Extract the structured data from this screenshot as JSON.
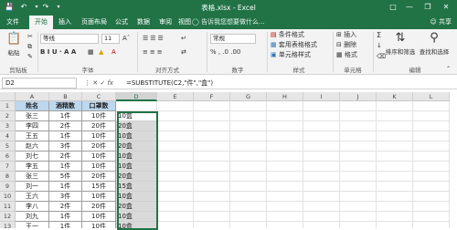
{
  "titlebar": {
    "title": "表格.xlsx - Excel",
    "icons": [
      "save-icon",
      "undo-icon",
      "redo-icon",
      "customize-icon"
    ],
    "window_buttons": [
      "ribbon-options-icon",
      "minimize-icon",
      "restore-icon",
      "close-icon"
    ]
  },
  "tabs": [
    "文件",
    "开始",
    "插入",
    "页面布局",
    "公式",
    "数据",
    "审阅",
    "视图"
  ],
  "active_tab": "开始",
  "tell_me": "告诉我您想要做什么...",
  "share": "共享",
  "ribbon": {
    "paste": "粘贴",
    "font_name": "等线",
    "font_size": "11",
    "font_buttons": "B I U · A A",
    "number_format": "常规",
    "number_buttons": "% , .0 .00",
    "conditional_format": "条件格式",
    "table_format": "套用表格格式",
    "cell_style": "单元格样式",
    "insert": "插入",
    "delete": "删除",
    "format": "格式",
    "sort_filter": "排序和筛选",
    "find_select": "查找和选择",
    "groups": {
      "clipboard": "剪贴板",
      "font": "字体",
      "alignment": "对齐方式",
      "number": "数字",
      "styles": "样式",
      "cells": "单元格",
      "editing": "编辑"
    }
  },
  "formula_bar": {
    "name_box": "D2",
    "fx": "fx",
    "formula": "=SUBSTITUTE(C2,\"件\",\"盒\")"
  },
  "grid": {
    "columns": [
      "A",
      "B",
      "C",
      "D",
      "E",
      "F",
      "G",
      "H",
      "I",
      "J",
      "K",
      "L"
    ],
    "selected_column": "D",
    "rows": [
      {
        "n": "1",
        "a": "姓名",
        "b": "酒精数",
        "c": "口罩数",
        "d": ""
      },
      {
        "n": "2",
        "a": "张三",
        "b": "1件",
        "c": "10件",
        "d": "10盒"
      },
      {
        "n": "3",
        "a": "李四",
        "b": "2件",
        "c": "20件",
        "d": "20盒"
      },
      {
        "n": "4",
        "a": "王五",
        "b": "1件",
        "c": "10件",
        "d": "10盒"
      },
      {
        "n": "5",
        "a": "赵六",
        "b": "3件",
        "c": "20件",
        "d": "20盒"
      },
      {
        "n": "6",
        "a": "刘七",
        "b": "2件",
        "c": "10件",
        "d": "10盒"
      },
      {
        "n": "7",
        "a": "李五",
        "b": "1件",
        "c": "10件",
        "d": "10盒"
      },
      {
        "n": "8",
        "a": "张三",
        "b": "5件",
        "c": "20件",
        "d": "20盒"
      },
      {
        "n": "9",
        "a": "刘一",
        "b": "1件",
        "c": "15件",
        "d": "15盒"
      },
      {
        "n": "10",
        "a": "王六",
        "b": "3件",
        "c": "10件",
        "d": "10盒"
      },
      {
        "n": "11",
        "a": "李八",
        "b": "2件",
        "c": "20件",
        "d": "20盒"
      },
      {
        "n": "12",
        "a": "刘九",
        "b": "1件",
        "c": "10件",
        "d": "10盒"
      },
      {
        "n": "13",
        "a": "王一",
        "b": "1件",
        "c": "10件",
        "d": "10盒"
      }
    ]
  }
}
